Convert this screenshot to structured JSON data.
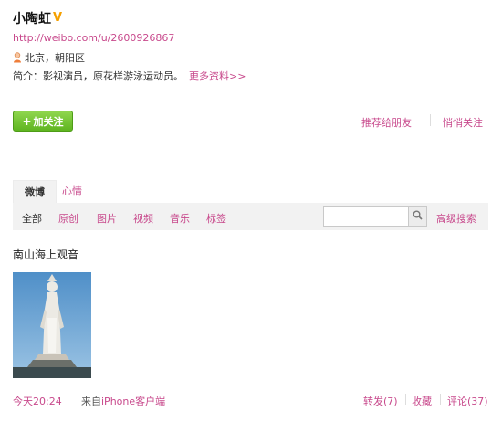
{
  "profile": {
    "name": "小陶虹",
    "verified_badge": "V",
    "url": "http://weibo.com/u/2600926867",
    "location": "北京，朝阳区",
    "bio": "简介：影视演员，原花样游泳运动员。",
    "more_info": "更多资料>>"
  },
  "actions": {
    "follow": "加关注",
    "follow_plus": "+",
    "recommend": "推荐给朋友",
    "unfollow": "悄悄关注"
  },
  "tabs": {
    "weibo": "微博",
    "mood": "心情"
  },
  "filters": {
    "all": "全部",
    "original": "原创",
    "pictures": "图片",
    "video": "视频",
    "music": "音乐",
    "tags": "标签",
    "advanced_search": "高级搜索",
    "search_value": ""
  },
  "post": {
    "text": "南山海上观音",
    "time": "今天20:24",
    "source_prefix": "来自",
    "source": "iPhone客户端",
    "repost": "转发(7)",
    "favorite": "收藏",
    "comment": "评论(37)"
  },
  "colors": {
    "link": "#c8498c",
    "follow_button": "#6cbf2a",
    "badge": "#f5a000"
  }
}
